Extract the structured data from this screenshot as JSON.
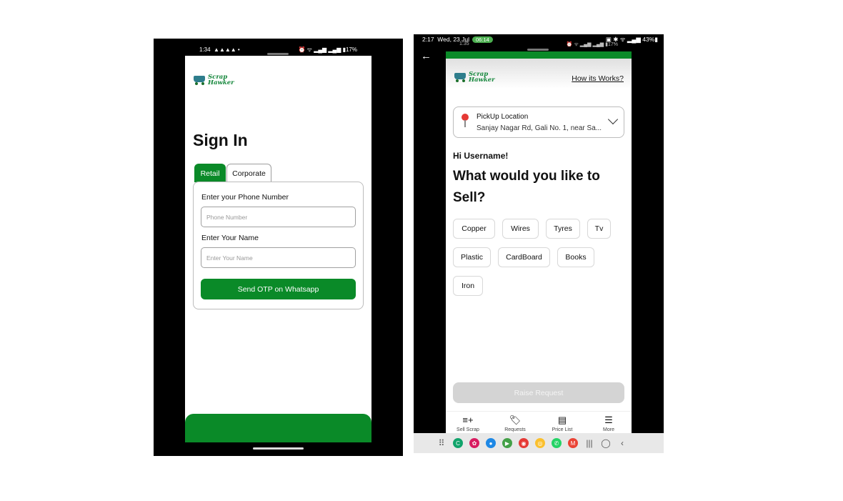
{
  "left_phone": {
    "status": {
      "time": "1:34",
      "notif_icons": "▲▲▲▲ •",
      "right": "⏰ ᯤ ▂▄▆ ▂▄▆ ▮17%"
    },
    "logo": {
      "line1": "Scrap",
      "line2": "Hawker"
    },
    "title": "Sign In",
    "tabs": [
      {
        "label": "Retail",
        "active": true
      },
      {
        "label": "Corporate",
        "active": false
      }
    ],
    "phone": {
      "label": "Enter your Phone Number",
      "placeholder": "Phone Number"
    },
    "name": {
      "label": "Enter Your Name",
      "placeholder": "Enter Your Name"
    },
    "submit_label": "Send OTP on Whatsapp"
  },
  "right_phone": {
    "outer_status": {
      "time": "2:17",
      "date": "Wed, 23 Jul",
      "call": "06:14",
      "right": "▣ ✱ ᯤ ▂▄▆ 43%▮"
    },
    "inner_status": {
      "time": "1:35",
      "right": "⏰ ᯤ ▂▄▆ ▂▄▆ ▮17%"
    },
    "back_arrow": "←",
    "logo": {
      "line1": "Scrap",
      "line2": "Hawker"
    },
    "how_link": "How its Works?",
    "location": {
      "title": "PickUp Location",
      "address": "Sanjay Nagar Rd, Gali No. 1, near Sa..."
    },
    "greeting": "Hi Username!",
    "question": "What would you like to Sell?",
    "categories": [
      "Copper",
      "Wires",
      "Tyres",
      "Tv",
      "Plastic",
      "CardBoard",
      "Books",
      "Iron"
    ],
    "raise_label": "Raise Request",
    "bottom_nav": [
      {
        "icon": "sell-list-icon",
        "glyph": "≡+",
        "label": "Sell Scrap"
      },
      {
        "icon": "tag-icon",
        "glyph": "🏷",
        "label": "Requests"
      },
      {
        "icon": "price-list-icon",
        "glyph": "▤",
        "label": "Price List"
      },
      {
        "icon": "more-menu-icon",
        "glyph": "☰",
        "label": "More"
      }
    ],
    "colors": {
      "brand_green": "#0a8a28",
      "pin_red": "#e53935"
    }
  }
}
